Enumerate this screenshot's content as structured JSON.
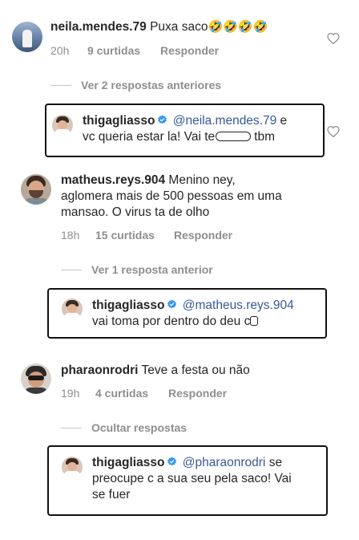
{
  "comments": [
    {
      "username": "neila.mendes.79",
      "text": "Puxa saco",
      "emoji": "🤣🤣🤣🤣",
      "time": "20h",
      "likes": "9 curtidas",
      "reply": "Responder",
      "view_replies": "Ver 2 respostas anteriores"
    },
    {
      "username": "matheus.reys.904",
      "text_line1": "Menino ney,",
      "text_line2": "aglomera mais de 500 pessoas em uma",
      "text_line3": "mansao. O virus ta de olho",
      "time": "18h",
      "likes": "15 curtidas",
      "reply": "Responder",
      "view_replies": "Ver 1 resposta anterior"
    },
    {
      "username": "pharaonrodri",
      "text": "Teve a festa ou não",
      "time": "19h",
      "likes": "4 curtidas",
      "reply": "Responder",
      "view_replies": "Ocultar respostas"
    }
  ],
  "replies": [
    {
      "username": "thigagliasso",
      "mention": "@neila.mendes.79",
      "text_a": "e",
      "text_b": "vc queria estar la! Vai te",
      "text_c": "tbm"
    },
    {
      "username": "thigagliasso",
      "mention": "@matheus.reys.904",
      "text_a": "vai toma por dentro do deu c"
    },
    {
      "username": "thigagliasso",
      "mention": "@pharaonrodri",
      "text_a": "se",
      "text_b": "preocupe c a sua seu pela saco! Vai",
      "text_c": "se fuer"
    }
  ],
  "colors": {
    "mention": "#385898",
    "verified": "#3897f0",
    "muted": "#8e8e8e"
  }
}
